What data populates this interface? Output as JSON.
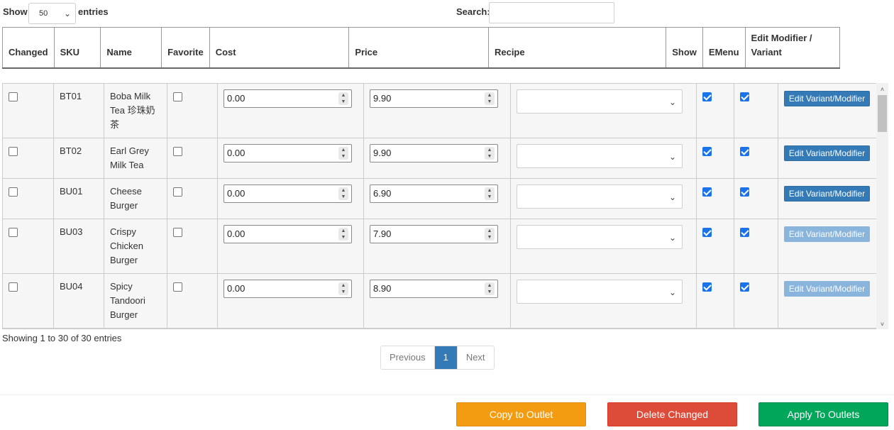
{
  "controls": {
    "show_label": "Show",
    "page_length": "50",
    "entries_label": "entries",
    "search_label": "Search:",
    "search_value": ""
  },
  "headers": [
    "Changed",
    "SKU",
    "Name",
    "Favorite",
    "Cost",
    "Price",
    "Recipe",
    "Show",
    "EMenu",
    "Edit Modifier / Variant"
  ],
  "rows": [
    {
      "sku": "BT01",
      "name": "Boba Milk Tea 珍珠奶茶",
      "cost": "0.00",
      "price": "9.90",
      "edit_label": "Edit Variant/Modifier"
    },
    {
      "sku": "BT02",
      "name": "Earl Grey Milk Tea",
      "cost": "0.00",
      "price": "9.90",
      "edit_label": "Edit Variant/Modifier"
    },
    {
      "sku": "BU01",
      "name": "Cheese Burger",
      "cost": "0.00",
      "price": "6.90",
      "edit_label": "Edit Variant/Modifier"
    },
    {
      "sku": "BU03",
      "name": "Crispy Chicken Burger",
      "cost": "0.00",
      "price": "7.90",
      "edit_label": "Edit Variant/Modifier"
    },
    {
      "sku": "BU04",
      "name": "Spicy Tandoori Burger",
      "cost": "0.00",
      "price": "8.90",
      "edit_label": "Edit Variant/Modifier"
    }
  ],
  "info": "Showing 1 to 30 of 30 entries",
  "pagination": {
    "previous": "Previous",
    "current": "1",
    "next": "Next"
  },
  "actions": {
    "copy": "Copy to Outlet",
    "delete": "Delete Changed",
    "apply": "Apply To Outlets"
  },
  "colors": {
    "primary": "#337ab7",
    "copy": "#f39c12",
    "delete": "#dd4b39",
    "apply": "#00a65a",
    "checkbox": "#1a73e8"
  }
}
